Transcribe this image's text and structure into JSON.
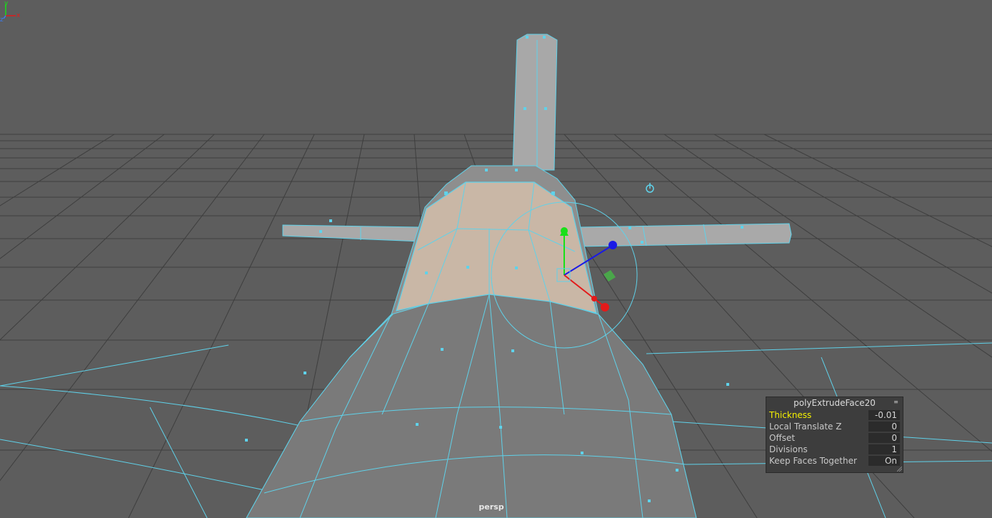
{
  "viewport": {
    "camera": "persp",
    "colors": {
      "background": "#5d5d5d",
      "grid": "#3a3a3a",
      "wireframe": "#5fd2ea",
      "selected_face": "#c9b7a6",
      "gizmo_x": "#e31a1a",
      "gizmo_y": "#18e018",
      "gizmo_z": "#1a1ae6",
      "hud_highlight": "#f4f000"
    }
  },
  "axis_indicator": {
    "x": "x",
    "y": "y",
    "z": "z"
  },
  "hud": {
    "title": "polyExtrudeFace20",
    "menu_icon": "menu-icon",
    "rows": [
      {
        "label": "Thickness",
        "value": "-0.01",
        "active": true
      },
      {
        "label": "Local Translate Z",
        "value": "0",
        "active": false
      },
      {
        "label": "Offset",
        "value": "0",
        "active": false
      },
      {
        "label": "Divisions",
        "value": "1",
        "active": false
      },
      {
        "label": "Keep Faces Together",
        "value": "On",
        "active": false
      }
    ]
  }
}
